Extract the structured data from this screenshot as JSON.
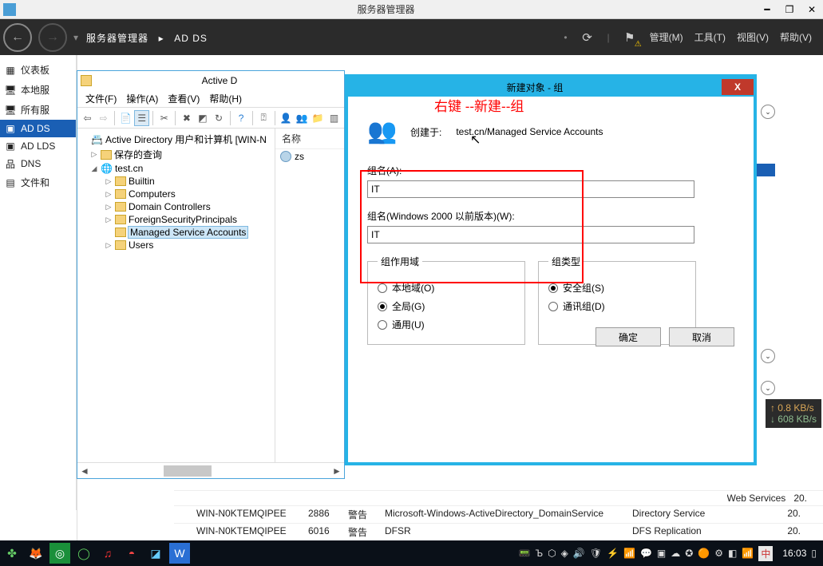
{
  "window": {
    "title": "服务器管理器"
  },
  "header": {
    "breadcrumb_left": "服务器管理器",
    "breadcrumb_sep": "▸",
    "breadcrumb_right": "AD DS",
    "menu": {
      "manage": "管理(M)",
      "tools": "工具(T)",
      "view": "视图(V)",
      "help": "帮助(V)"
    }
  },
  "leftnav": {
    "items": [
      "仪表板",
      "本地服",
      "所有服",
      "AD DS",
      "AD LDS",
      "DNS",
      "文件和"
    ]
  },
  "ad_window": {
    "title": "Active D",
    "menus": {
      "file": "文件(F)",
      "action": "操作(A)",
      "view": "查看(V)",
      "help": "帮助(H)"
    },
    "tree": {
      "root": "Active Directory 用户和计算机 [WIN-N",
      "saved": "保存的查询",
      "domain": "test.cn",
      "children": [
        "Builtin",
        "Computers",
        "Domain Controllers",
        "ForeignSecurityPrincipals",
        "Managed Service Accounts",
        "Users"
      ]
    },
    "list": {
      "col_name": "名称",
      "row0": "zs"
    }
  },
  "dialog": {
    "title": "新建对象 - 组",
    "annotation": "右键 --新建--组",
    "created_in_label": "创建于:",
    "created_in_value": "test.cn/Managed Service Accounts",
    "groupname_label": "组名(A):",
    "groupname_value": "IT",
    "groupname2000_label": "组名(Windows 2000 以前版本)(W):",
    "groupname2000_value": "IT",
    "scope": {
      "legend": "组作用域",
      "local": "本地域(O)",
      "global": "全局(G)",
      "universal": "通用(U)"
    },
    "type": {
      "legend": "组类型",
      "security": "安全组(S)",
      "distribution": "通讯组(D)"
    },
    "ok": "确定",
    "cancel": "取消"
  },
  "netspeed": {
    "up": "↑ 0.8 KB/s",
    "down": "↓ 608 KB/s"
  },
  "events": {
    "row_top_service": "Web Services",
    "row_top_num": "20.",
    "rows": [
      {
        "src": "WIN-N0KTEMQIPEE",
        "id": "2886",
        "lvl": "警告",
        "svc": "Microsoft-Windows-ActiveDirectory_DomainService",
        "cat": "Directory Service",
        "t": "20."
      },
      {
        "src": "WIN-N0KTEMQIPEE",
        "id": "6016",
        "lvl": "警告",
        "svc": "DFSR",
        "cat": "DFS Replication",
        "t": "20."
      }
    ]
  },
  "taskbar": {
    "clock": "16:03",
    "ime": "中"
  }
}
